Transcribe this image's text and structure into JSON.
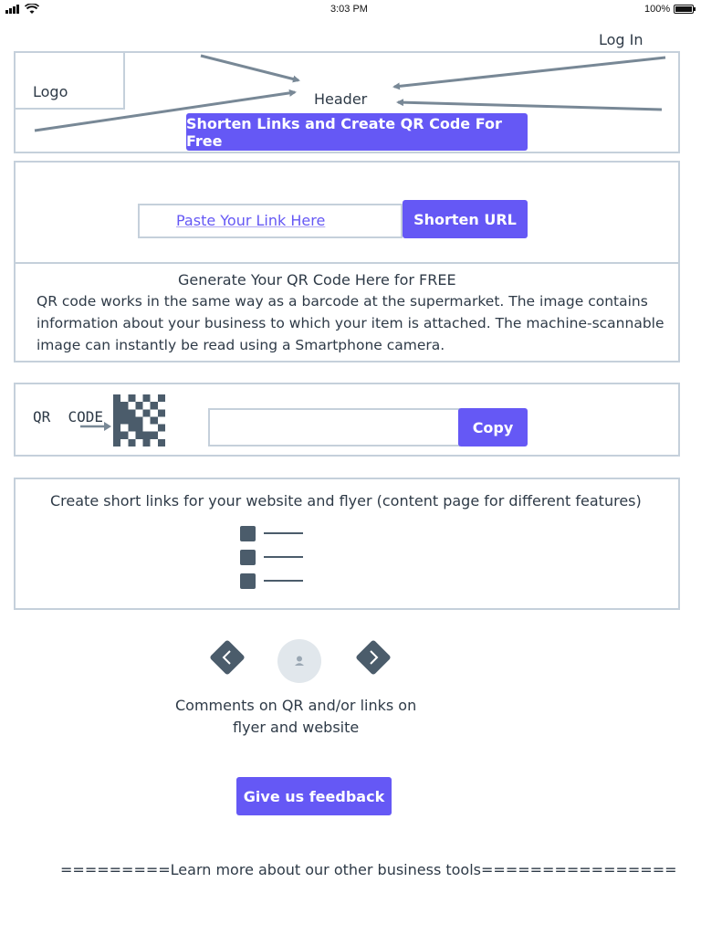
{
  "status_bar": {
    "time": "3:03 PM",
    "battery": "100%"
  },
  "header": {
    "login": "Log In",
    "logo": "Logo",
    "title": "Header",
    "cta": "Shorten Links and Create QR Code For Free"
  },
  "shortener": {
    "link_placeholder": "Paste Your Link Here",
    "shorten_button": "Shorten URL"
  },
  "qr_info": {
    "heading": "Generate Your QR Code Here for FREE",
    "lines": [
      "QR code works in the same way as a barcode at the supermarket. The image contains",
      "information about your business to which your item is attached. The machine-scannable",
      "image can instantly be read using a Smartphone camera."
    ]
  },
  "qr_result": {
    "label": "QR  CODE",
    "output_value": "",
    "copy_button": "Copy"
  },
  "content_section": {
    "text": "Create short links for your website and flyer (content page for different features)"
  },
  "comments": {
    "line1": "Comments on QR and/or links on",
    "line2": "flyer and website"
  },
  "feedback": {
    "button": "Give us feedback"
  },
  "footer": {
    "text": "=========Learn more about our other business tools================"
  },
  "colors": {
    "accent": "#6558f5",
    "border": "#c5d0db",
    "dark_icon": "#4b5c6b"
  }
}
